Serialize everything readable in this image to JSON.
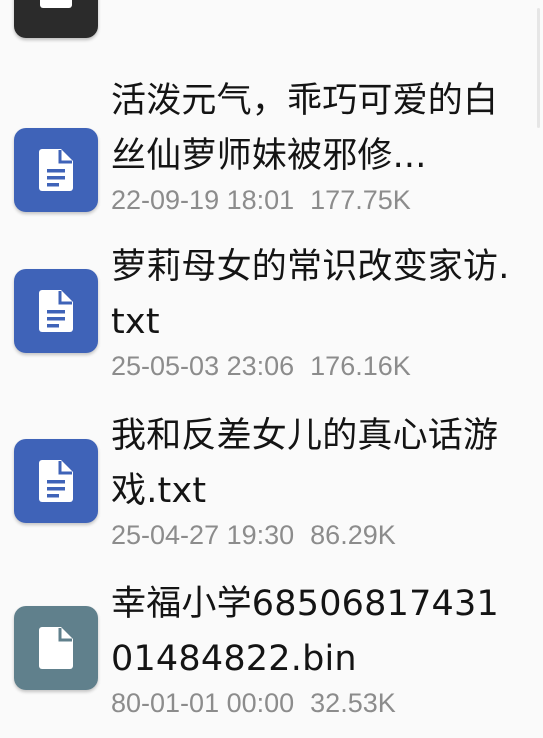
{
  "colors": {
    "doc_icon_bg": "#3f63b8",
    "bin_icon_bg": "#60808c",
    "partial_icon_bg": "#2b2b2b",
    "name_text": "#141414",
    "meta_text": "#8c8c8c"
  },
  "partial_item": {
    "icon": "folder-icon"
  },
  "files": [
    {
      "name": "活泼元气，乖巧可爱的白丝仙萝师妹被邪修...",
      "date": "22-09-19 18:01",
      "size": "177.75K",
      "icon": "document-icon"
    },
    {
      "name": "萝莉母女的常识改变家访.txt",
      "date": "25-05-03 23:06",
      "size": "176.16K",
      "icon": "document-icon"
    },
    {
      "name": "我和反差女儿的真心话游戏.txt",
      "date": "25-04-27 19:30",
      "size": "86.29K",
      "icon": "document-icon"
    },
    {
      "name": "幸福小学6850681743101484822.bin",
      "date": "80-01-01 00:00",
      "size": "32.53K",
      "icon": "file-icon"
    }
  ]
}
